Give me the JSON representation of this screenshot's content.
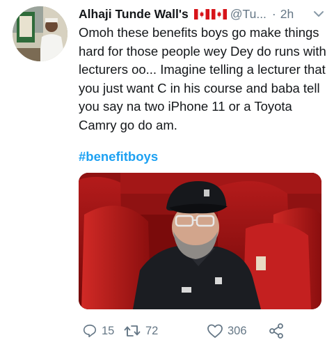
{
  "tweet": {
    "author_name": "Alhaji Tunde Wall's",
    "handle": "@Tu...",
    "separator": "·",
    "time": "2h",
    "text": "Omoh these benefits boys go make things hard for those people wey Dey do runs with lecturers oo... Imagine telling a lecturer that you just want C in his course and baba tell you say na two iPhone 11 or a Toyota Camry go do am.",
    "hashtag": "#benefitboys",
    "icons": {
      "flags": "canada-flag-icon",
      "menu": "chevron-down-icon",
      "reply": "reply-icon",
      "retweet": "retweet-icon",
      "like": "heart-icon",
      "share": "share-icon"
    },
    "stats": {
      "replies": "15",
      "retweets": "72",
      "likes": "306"
    },
    "colors": {
      "link": "#1da1f2",
      "muted": "#657786",
      "text": "#14171a"
    }
  }
}
